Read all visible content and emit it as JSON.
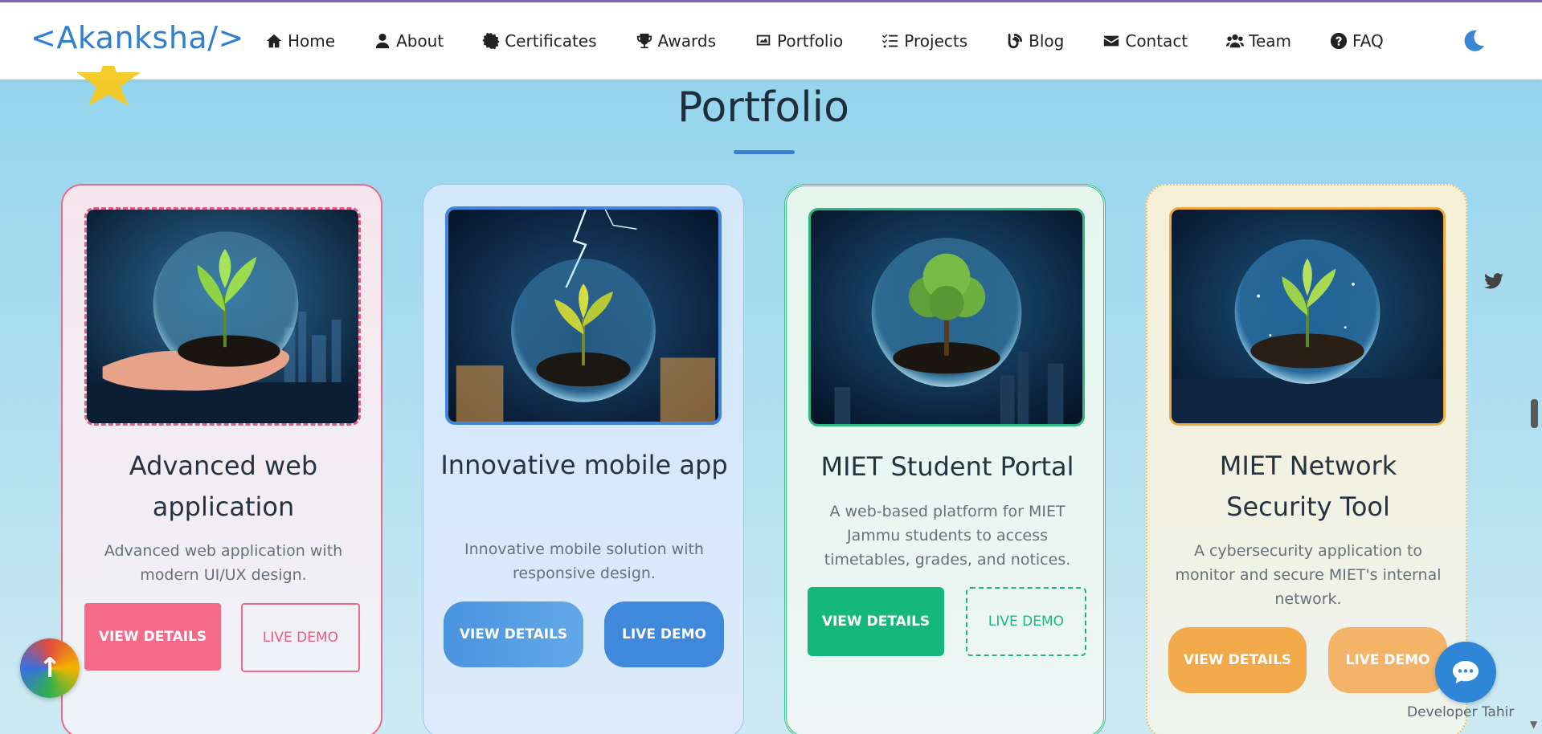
{
  "brand": {
    "logo": "<Akanksha/>"
  },
  "nav": {
    "items": [
      {
        "label": "Home",
        "icon": "home-icon"
      },
      {
        "label": "About",
        "icon": "user-icon"
      },
      {
        "label": "Certificates",
        "icon": "certificate-icon"
      },
      {
        "label": "Awards",
        "icon": "trophy-icon"
      },
      {
        "label": "Portfolio",
        "icon": "image-icon"
      },
      {
        "label": "Projects",
        "icon": "tasks-icon"
      },
      {
        "label": "Blog",
        "icon": "blog-icon"
      },
      {
        "label": "Contact",
        "icon": "envelope-icon"
      },
      {
        "label": "Team",
        "icon": "users-icon"
      },
      {
        "label": "FAQ",
        "icon": "question-icon"
      }
    ],
    "theme_toggle_icon": "moon-icon"
  },
  "section": {
    "title": "Portfolio"
  },
  "cards": [
    {
      "title": "Advanced web application",
      "description": "Advanced web application with modern UI/UX design.",
      "view_label": "VIEW DETAILS",
      "demo_label": "LIVE DEMO",
      "accent": "#ec6a8b"
    },
    {
      "title": "Innovative mobile app",
      "description": "Innovative mobile solution with responsive design.",
      "view_label": "VIEW DETAILS",
      "demo_label": "LIVE DEMO",
      "accent": "#3f88dc"
    },
    {
      "title": "MIET Student Portal",
      "description": "A web-based platform for MIET Jammu students to access timetables, grades, and notices.",
      "view_label": "VIEW DETAILS",
      "demo_label": "LIVE DEMO",
      "accent": "#13b87a"
    },
    {
      "title": "MIET Network Security Tool",
      "description": "A cybersecurity application to monitor and secure MIET's internal network.",
      "view_label": "VIEW DETAILS",
      "demo_label": "LIVE DEMO",
      "accent": "#f2a94a"
    }
  ],
  "floating": {
    "back_to_top_icon": "arrow-up-icon",
    "chat_icon": "chat-icon",
    "social_icon": "twitter-icon",
    "developer_credit": "Developer Tahir"
  }
}
